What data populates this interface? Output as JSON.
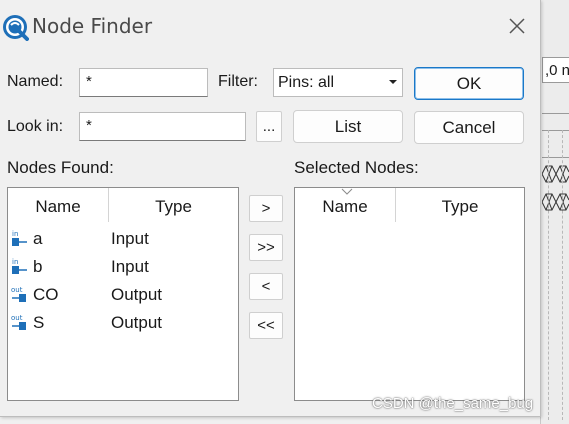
{
  "dialog": {
    "title": "Node Finder",
    "named_label": "Named:",
    "named_value": "*",
    "filter_label": "Filter:",
    "filter_value": "Pins: all",
    "look_in_label": "Look in:",
    "look_in_value": "*",
    "browse_label": "...",
    "list_button": "List",
    "ok_button": "OK",
    "cancel_button": "Cancel",
    "nodes_found_label": "Nodes Found:",
    "selected_nodes_label": "Selected Nodes:",
    "columns": {
      "name": "Name",
      "type": "Type"
    },
    "nodes_found": [
      {
        "icon": "input-pin-icon",
        "icon_text": "in",
        "name": "a",
        "type": "Input"
      },
      {
        "icon": "input-pin-icon",
        "icon_text": "in",
        "name": "b",
        "type": "Input"
      },
      {
        "icon": "output-pin-icon",
        "icon_text": "out",
        "name": "CO",
        "type": "Output"
      },
      {
        "icon": "output-pin-icon",
        "icon_text": "out",
        "name": "S",
        "type": "Output"
      }
    ],
    "transfer_buttons": [
      ">",
      ">>",
      "<",
      "<<"
    ]
  },
  "background": {
    "field_text": ",0 n"
  },
  "watermark": "CSDN @the_same_bug",
  "colors": {
    "accent": "#1a78c8",
    "icon_blue": "#1e6fb8"
  }
}
